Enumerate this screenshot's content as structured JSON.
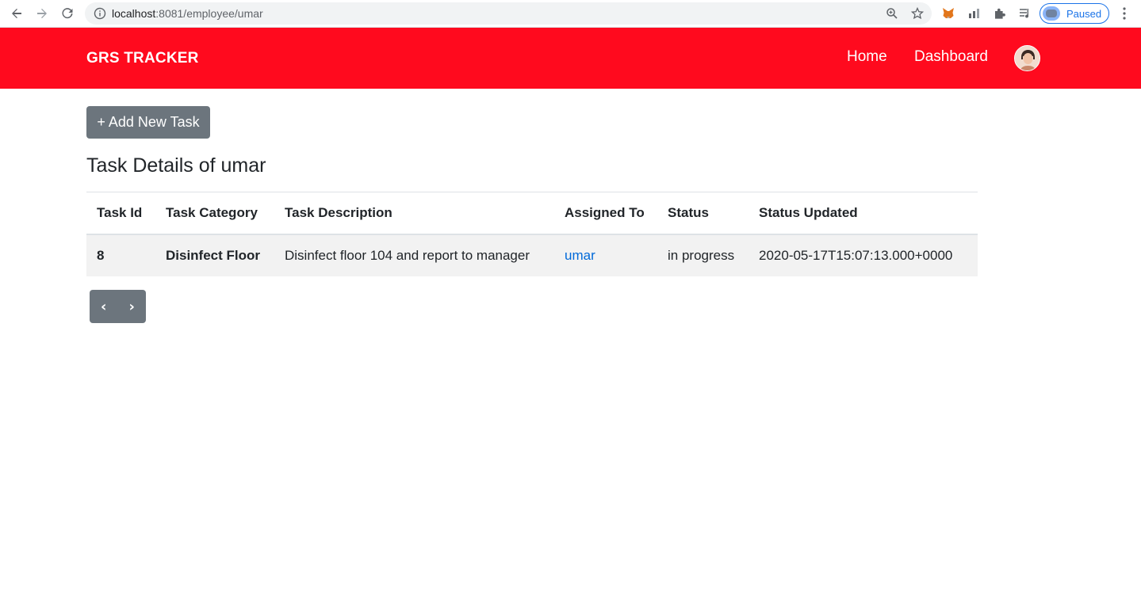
{
  "browser": {
    "url_host": "localhost",
    "url_rest": ":8081/employee/umar",
    "profile_status": "Paused"
  },
  "navbar": {
    "brand": "GRS TRACKER",
    "links": [
      "Home",
      "Dashboard"
    ],
    "background": "#ff0a1e"
  },
  "actions": {
    "add_task_label": "+ Add New Task"
  },
  "page": {
    "title": "Task Details of umar"
  },
  "table": {
    "headers": [
      "Task Id",
      "Task Category",
      "Task Description",
      "Assigned To",
      "Status",
      "Status Updated"
    ],
    "rows": [
      {
        "task_id": "8",
        "category": "Disinfect Floor",
        "description": "Disinfect floor 104 and report to manager",
        "assigned_to": "umar",
        "status": "in progress",
        "status_updated": "2020-05-17T15:07:13.000+0000"
      }
    ]
  },
  "pagination": {
    "prev": "‹",
    "next": "›"
  }
}
